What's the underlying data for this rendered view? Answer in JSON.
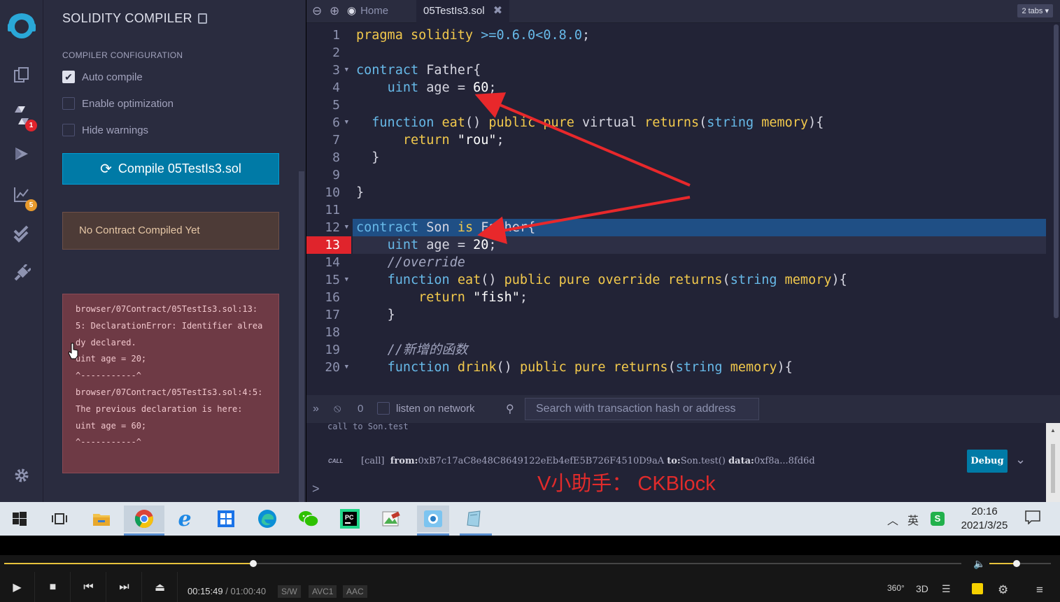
{
  "sidebar": {
    "badges": {
      "compiler": "1",
      "analysis": "5"
    },
    "icons": [
      "remix-logo",
      "file-explorer-icon",
      "solidity-compiler-icon",
      "deploy-run-icon",
      "analysis-icon",
      "unit-test-icon",
      "plugin-manager-icon",
      "settings-icon"
    ]
  },
  "compiler": {
    "title": "SOLIDITY COMPILER",
    "section_title": "COMPILER CONFIGURATION",
    "auto_compile": {
      "label": "Auto compile",
      "checked": true
    },
    "enable_optimization": {
      "label": "Enable optimization",
      "checked": false
    },
    "hide_warnings": {
      "label": "Hide warnings",
      "checked": false
    },
    "compile_button": "Compile 05TestIs3.sol",
    "no_contract": "No Contract Compiled Yet",
    "error_lines": [
      "browser/07Contract/05TestIs3.sol:13:5: DeclarationError: Identifier already declared.",
      "uint age = 20;",
      "^-----------^",
      "browser/07Contract/05TestIs3.sol:4:5: The previous declaration is here:",
      "uint age = 60;",
      "^-----------^"
    ]
  },
  "editor": {
    "home_tab": "Home",
    "file_tab": "05TestIs3.sol",
    "tabs_count": "2 tabs",
    "error_line": 13,
    "line_numbers": [
      "1",
      "2",
      "3",
      "4",
      "5",
      "6",
      "7",
      "8",
      "9",
      "10",
      "11",
      "12",
      "13",
      "14",
      "15",
      "16",
      "17",
      "18",
      "19",
      "20"
    ]
  },
  "terminal": {
    "pending_count": "0",
    "listen_label": "listen on network",
    "search_placeholder": "Search with transaction hash or address",
    "prev_call": "call to Son.test",
    "call_tag": "CALL",
    "call_prefix": "[call]",
    "from_label": "from:",
    "from_value": "0xB7c17aC8e48C8649122eEb4efE5B726F4510D9aA",
    "to_label": "to:",
    "to_value": "Son.test()",
    "data_label": "data:",
    "data_value": "0xf8a...8fd6d",
    "debug_button": "Debug",
    "prompt": ">",
    "watermark": "V小助手： CKBlock"
  },
  "taskbar": {
    "apps": [
      "windows-start",
      "task-view",
      "file-explorer",
      "chrome",
      "internet-explorer",
      "microsoft-store",
      "edge",
      "wechat",
      "pycharm",
      "image-viewer",
      "remote-app",
      "notes-app"
    ],
    "ime": "英",
    "time": "20:16",
    "date": "2021/3/25"
  },
  "player": {
    "current_time": "00:15:49",
    "separator": "/",
    "total_time": "01:00:40",
    "tags": [
      "S/W",
      "AVC1",
      "AAC"
    ],
    "progress": 0.26,
    "volume": 0.44,
    "right_labels": {
      "vr": "360°",
      "three_d": "3D"
    }
  },
  "colors": {
    "panel_bg": "#2a2c3f",
    "editor_bg": "#222336",
    "accent": "#007aa6",
    "error_bg": "#6e3a45",
    "keyword": "#f2c94c",
    "type": "#67b9e8",
    "arrow": "#e8282b"
  }
}
